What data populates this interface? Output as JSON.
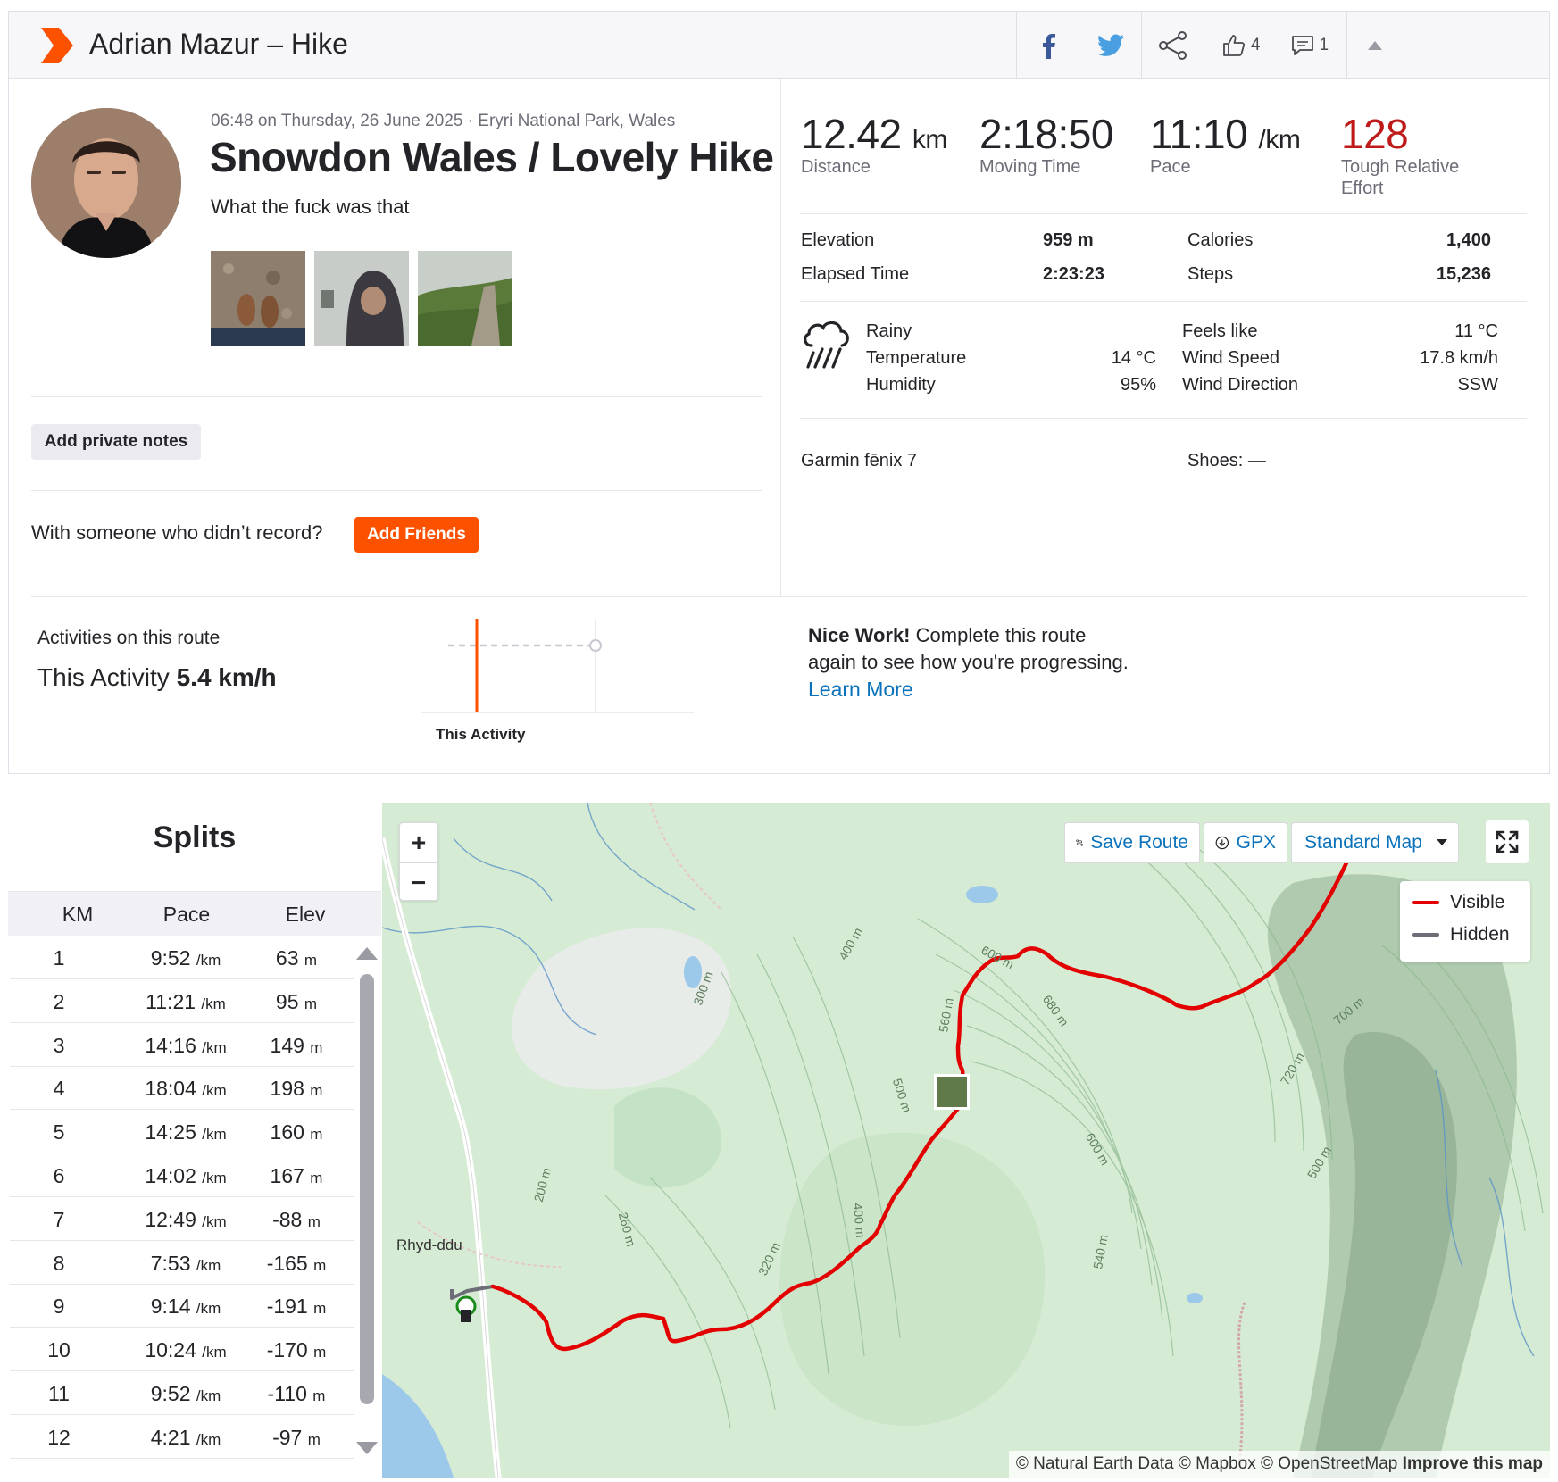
{
  "header": {
    "title": "Adrian Mazur – Hike",
    "kudos_count": "4",
    "comment_count": "1"
  },
  "activity": {
    "meta": "06:48 on Thursday, 26 June 2025 · Eryri National Park, Wales",
    "name": "Snowdon Wales / Lovely Hike",
    "description": "What the fuck was that",
    "photos": [
      "boots-on-trail",
      "hooded-selfie",
      "misty-hillside"
    ]
  },
  "notes_button": "Add private notes",
  "friends": {
    "question": "With someone who didn’t record?",
    "button": "Add Friends"
  },
  "stats": {
    "distance": {
      "value": "12.42",
      "unit": "km",
      "label": "Distance"
    },
    "moving_time": {
      "value": "2:18:50",
      "label": "Moving Time"
    },
    "pace": {
      "value": "11:10",
      "unit": "/km",
      "label": "Pace"
    },
    "effort": {
      "value": "128",
      "label": "Tough Relative Effort",
      "color": "#bf1a1a"
    }
  },
  "details": {
    "elevation_label": "Elevation",
    "elevation_value": "959 m",
    "elapsed_label": "Elapsed Time",
    "elapsed_value": "2:23:23",
    "calories_label": "Calories",
    "calories_value": "1,400",
    "steps_label": "Steps",
    "steps_value": "15,236"
  },
  "weather": {
    "icon": "rain-cloud-icon",
    "condition": "Rainy",
    "temp_label": "Temperature",
    "temp_value": "14 °C",
    "humidity_label": "Humidity",
    "humidity_value": "95%",
    "feels_label": "Feels like",
    "feels_value": "11 °C",
    "wind_speed_label": "Wind Speed",
    "wind_speed_value": "17.8 km/h",
    "wind_dir_label": "Wind Direction",
    "wind_dir_value": "SSW"
  },
  "gear": {
    "device": "Garmin fēnix 7",
    "shoes": "Shoes: —"
  },
  "route": {
    "heading": "Activities on this route",
    "this_label": "This Activity",
    "this_speed": "5.4 km/h",
    "chart_label": "This Activity",
    "nice_bold": "Nice Work!",
    "nice_text": " Complete this route again to see how you're progressing.",
    "learn_more": "Learn More"
  },
  "splits": {
    "title": "Splits",
    "columns": [
      "KM",
      "Pace",
      "Elev"
    ],
    "pace_unit": "/km",
    "elev_unit": "m",
    "rows": [
      {
        "km": "1",
        "pace": "9:52",
        "elev": "63"
      },
      {
        "km": "2",
        "pace": "11:21",
        "elev": "95"
      },
      {
        "km": "3",
        "pace": "14:16",
        "elev": "149"
      },
      {
        "km": "4",
        "pace": "18:04",
        "elev": "198"
      },
      {
        "km": "5",
        "pace": "14:25",
        "elev": "160"
      },
      {
        "km": "6",
        "pace": "14:02",
        "elev": "167"
      },
      {
        "km": "7",
        "pace": "12:49",
        "elev": "-88"
      },
      {
        "km": "8",
        "pace": "7:53",
        "elev": "-165"
      },
      {
        "km": "9",
        "pace": "9:14",
        "elev": "-191"
      },
      {
        "km": "10",
        "pace": "10:24",
        "elev": "-170"
      },
      {
        "km": "11",
        "pace": "9:52",
        "elev": "-110"
      },
      {
        "km": "12",
        "pace": "4:21",
        "elev": "-97"
      }
    ]
  },
  "map": {
    "save_route": "Save Route",
    "gpx": "GPX",
    "map_style": "Standard Map",
    "legend_visible": "Visible",
    "legend_hidden": "Hidden",
    "place_label": "Rhyd-ddu",
    "contours": [
      "400 m",
      "300 m",
      "600 m",
      "680 m",
      "560 m",
      "500 m",
      "700 m",
      "720 m",
      "600 m",
      "200 m",
      "260 m",
      "400 m",
      "320 m",
      "540 m",
      "500 m"
    ],
    "attribution_plain": "© Natural Earth Data © Mapbox © OpenStreetMap ",
    "attribution_link": "Improve this map",
    "route_color": "#e30000",
    "hidden_color": "#6d6d78"
  },
  "colors": {
    "brand": "#fc5200",
    "link": "#0a72bb"
  }
}
